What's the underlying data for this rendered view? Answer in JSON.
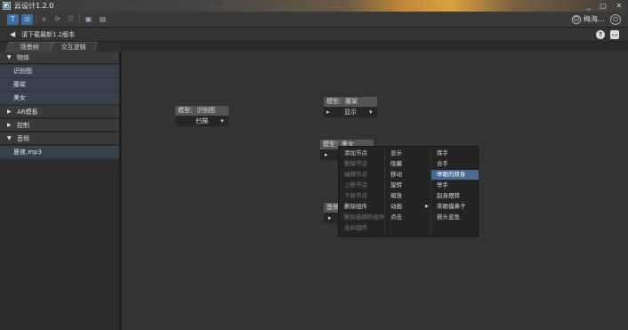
{
  "window": {
    "title": "云设计1.2.0",
    "icon": "app-icon",
    "min": "_",
    "max": "□",
    "close": "✕"
  },
  "toolbar": {
    "buttons": [
      {
        "name": "text-tool",
        "glyph": "T"
      },
      {
        "name": "marker-tool",
        "glyph": "⊙"
      },
      {
        "name": "add-tool",
        "glyph": "+"
      },
      {
        "name": "refresh-tool",
        "glyph": "⟳"
      },
      {
        "name": "fullscreen-tool",
        "glyph": "⤧"
      },
      {
        "name": "save-tool",
        "glyph": "▣"
      },
      {
        "name": "export-tool",
        "glyph": "▤"
      }
    ],
    "user_name": "梅海...",
    "avatar_glyph": "☺",
    "power_glyph": "⏻"
  },
  "notice": {
    "text": "请下载最新1.2版本",
    "speaker_glyph": "◀",
    "help_glyph": "?",
    "chat_glyph": "▭"
  },
  "tabs": [
    {
      "label": "场景树"
    },
    {
      "label": "交互逻辑"
    }
  ],
  "sidebar": {
    "sections": [
      {
        "label": "物体",
        "arrow": "▼",
        "items": [
          "识别图",
          "藤架",
          "美女"
        ]
      },
      {
        "label": "AR模板",
        "arrow": "▶"
      },
      {
        "label": "控制",
        "arrow": "▶"
      },
      {
        "label": "音频",
        "arrow": "▼",
        "items": [
          "夏夜.mp3"
        ]
      }
    ]
  },
  "nodes": {
    "recog": {
      "title": "模型：识别图",
      "action": "扫描",
      "dropdown": "▾"
    },
    "vine": {
      "title": "模型：藤架",
      "bullet": "▸",
      "action": "显示",
      "dropdown": "▾"
    },
    "beauty": {
      "title": "模型：美女",
      "bullet": "▸"
    },
    "audio": {
      "title": "音频",
      "bullet": "▸"
    }
  },
  "context_menu": {
    "col1": [
      {
        "label": "添加节点",
        "disabled": false
      },
      {
        "label": "删除节点",
        "disabled": true
      },
      {
        "label": "编辑节点",
        "disabled": true
      },
      {
        "label": "上移节点",
        "disabled": true
      },
      {
        "label": "下移节点",
        "disabled": true
      },
      {
        "label": "删除组件",
        "disabled": false
      },
      {
        "label": "删除选择的组件",
        "disabled": true
      },
      {
        "label": "合并组件",
        "disabled": true
      }
    ],
    "col2": [
      {
        "label": "显示"
      },
      {
        "label": "隐藏"
      },
      {
        "label": "移动"
      },
      {
        "label": "旋转"
      },
      {
        "label": "缩放"
      },
      {
        "label": "动画",
        "has_sub": true,
        "sub_arrow": "▶"
      },
      {
        "label": "点击"
      }
    ],
    "col3": [
      {
        "label": "挥手"
      },
      {
        "label": "合手"
      },
      {
        "label": "举眼的转身",
        "selected": true
      },
      {
        "label": "举手"
      },
      {
        "label": "起身摆转"
      },
      {
        "label": "笑眼摸鼻子"
      },
      {
        "label": "摇头蓝鱼"
      }
    ]
  }
}
